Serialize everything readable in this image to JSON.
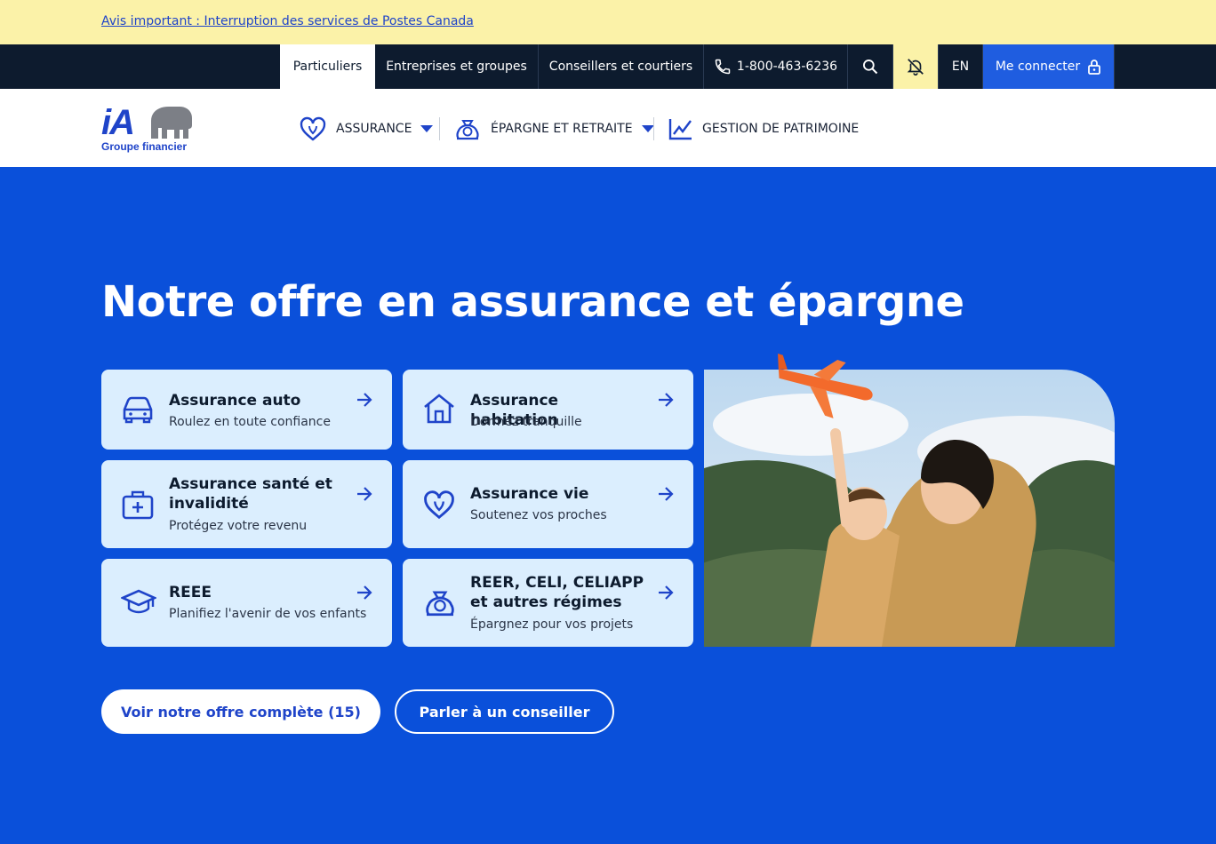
{
  "alert": {
    "text": "Avis important : Interruption des services de Postes Canada"
  },
  "top_nav": {
    "tabs": [
      "Particuliers",
      "Entreprises et groupes",
      "Conseillers et courtiers"
    ],
    "phone": "1-800-463-6236",
    "lang": "EN",
    "login": "Me connecter"
  },
  "logo": {
    "mark": "iA",
    "subtitle": "Groupe financier"
  },
  "main_nav": {
    "items": [
      "ASSURANCE",
      "ÉPARGNE ET RETRAITE",
      "GESTION DE PATRIMOINE"
    ]
  },
  "hero": {
    "title": "Notre offre en assurance et épargne"
  },
  "cards": [
    {
      "title": "Assurance auto",
      "subtitle": "Roulez en toute confiance",
      "icon": "car-icon"
    },
    {
      "title": "Assurance habitation",
      "subtitle": "Dormez tranquille",
      "icon": "house-icon"
    },
    {
      "title": "Assurance santé et invalidité",
      "subtitle": "Protégez votre revenu",
      "icon": "medical-kit-icon"
    },
    {
      "title": "Assurance vie",
      "subtitle": "Soutenez vos proches",
      "icon": "heart-icon"
    },
    {
      "title": "REEE",
      "subtitle": "Planifiez l'avenir de vos enfants",
      "icon": "graduation-cap-icon"
    },
    {
      "title": "REER, CELI, CELIAPP et autres régimes",
      "subtitle": "Épargnez pour vos projets",
      "icon": "savings-icon"
    }
  ],
  "buttons": {
    "primary": "Voir notre offre complète (15)",
    "secondary": "Parler à un conseiller"
  },
  "colors": {
    "brand_blue": "#0a50da",
    "alert_yellow": "#fbf2a8",
    "card_bg": "#dbeefe",
    "dark_nav": "#0d1b2e"
  }
}
